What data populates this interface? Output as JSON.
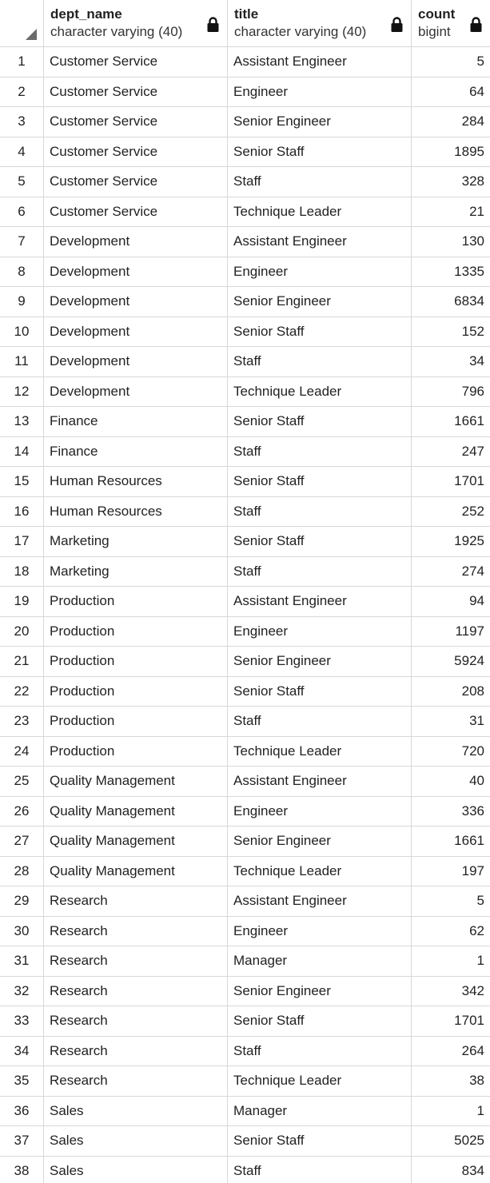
{
  "columns": [
    {
      "name": "dept_name",
      "type": "character varying (40)"
    },
    {
      "name": "title",
      "type": "character varying (40)"
    },
    {
      "name": "count",
      "type": "bigint"
    }
  ],
  "rows": [
    {
      "n": "1",
      "dept": "Customer Service",
      "title": "Assistant Engineer",
      "count": "5"
    },
    {
      "n": "2",
      "dept": "Customer Service",
      "title": "Engineer",
      "count": "64"
    },
    {
      "n": "3",
      "dept": "Customer Service",
      "title": "Senior Engineer",
      "count": "284"
    },
    {
      "n": "4",
      "dept": "Customer Service",
      "title": "Senior Staff",
      "count": "1895"
    },
    {
      "n": "5",
      "dept": "Customer Service",
      "title": "Staff",
      "count": "328"
    },
    {
      "n": "6",
      "dept": "Customer Service",
      "title": "Technique Leader",
      "count": "21"
    },
    {
      "n": "7",
      "dept": "Development",
      "title": "Assistant Engineer",
      "count": "130"
    },
    {
      "n": "8",
      "dept": "Development",
      "title": "Engineer",
      "count": "1335"
    },
    {
      "n": "9",
      "dept": "Development",
      "title": "Senior Engineer",
      "count": "6834"
    },
    {
      "n": "10",
      "dept": "Development",
      "title": "Senior Staff",
      "count": "152"
    },
    {
      "n": "11",
      "dept": "Development",
      "title": "Staff",
      "count": "34"
    },
    {
      "n": "12",
      "dept": "Development",
      "title": "Technique Leader",
      "count": "796"
    },
    {
      "n": "13",
      "dept": "Finance",
      "title": "Senior Staff",
      "count": "1661"
    },
    {
      "n": "14",
      "dept": "Finance",
      "title": "Staff",
      "count": "247"
    },
    {
      "n": "15",
      "dept": "Human Resources",
      "title": "Senior Staff",
      "count": "1701"
    },
    {
      "n": "16",
      "dept": "Human Resources",
      "title": "Staff",
      "count": "252"
    },
    {
      "n": "17",
      "dept": "Marketing",
      "title": "Senior Staff",
      "count": "1925"
    },
    {
      "n": "18",
      "dept": "Marketing",
      "title": "Staff",
      "count": "274"
    },
    {
      "n": "19",
      "dept": "Production",
      "title": "Assistant Engineer",
      "count": "94"
    },
    {
      "n": "20",
      "dept": "Production",
      "title": "Engineer",
      "count": "1197"
    },
    {
      "n": "21",
      "dept": "Production",
      "title": "Senior Engineer",
      "count": "5924"
    },
    {
      "n": "22",
      "dept": "Production",
      "title": "Senior Staff",
      "count": "208"
    },
    {
      "n": "23",
      "dept": "Production",
      "title": "Staff",
      "count": "31"
    },
    {
      "n": "24",
      "dept": "Production",
      "title": "Technique Leader",
      "count": "720"
    },
    {
      "n": "25",
      "dept": "Quality Management",
      "title": "Assistant Engineer",
      "count": "40"
    },
    {
      "n": "26",
      "dept": "Quality Management",
      "title": "Engineer",
      "count": "336"
    },
    {
      "n": "27",
      "dept": "Quality Management",
      "title": "Senior Engineer",
      "count": "1661"
    },
    {
      "n": "28",
      "dept": "Quality Management",
      "title": "Technique Leader",
      "count": "197"
    },
    {
      "n": "29",
      "dept": "Research",
      "title": "Assistant Engineer",
      "count": "5"
    },
    {
      "n": "30",
      "dept": "Research",
      "title": "Engineer",
      "count": "62"
    },
    {
      "n": "31",
      "dept": "Research",
      "title": "Manager",
      "count": "1"
    },
    {
      "n": "32",
      "dept": "Research",
      "title": "Senior Engineer",
      "count": "342"
    },
    {
      "n": "33",
      "dept": "Research",
      "title": "Senior Staff",
      "count": "1701"
    },
    {
      "n": "34",
      "dept": "Research",
      "title": "Staff",
      "count": "264"
    },
    {
      "n": "35",
      "dept": "Research",
      "title": "Technique Leader",
      "count": "38"
    },
    {
      "n": "36",
      "dept": "Sales",
      "title": "Manager",
      "count": "1"
    },
    {
      "n": "37",
      "dept": "Sales",
      "title": "Senior Staff",
      "count": "5025"
    },
    {
      "n": "38",
      "dept": "Sales",
      "title": "Staff",
      "count": "834"
    }
  ],
  "icons": {
    "column_lock": "lock-icon",
    "select_all": "select-all-corner-icon"
  },
  "colors": {
    "grid_line": "#d8d8d8",
    "text": "#222222",
    "lock": "#111111"
  }
}
